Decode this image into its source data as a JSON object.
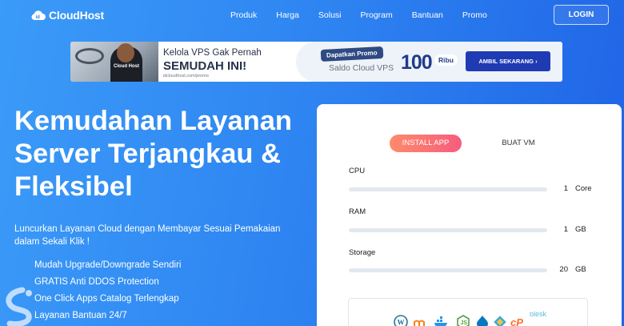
{
  "header": {
    "logo_badge": "id",
    "logo_text": "CloudHost",
    "menu": [
      "Produk",
      "Harga",
      "Solusi",
      "Program",
      "Bantuan",
      "Promo"
    ],
    "login_label": "LOGIN"
  },
  "banner": {
    "line1": "Kelola VPS Gak Pernah",
    "line2": "SEMUDAH INI!",
    "url": "idcloudhost.com/promo",
    "promo_tag": "Dapatkan Promo",
    "promo_sub": "Saldo Cloud VPS",
    "promo_amount": "100",
    "promo_unit": "Ribu",
    "cta_label": "AMBIL SEKARANG ›",
    "photo_shirt_text": "Cloud Host"
  },
  "hero": {
    "title": "Kemudahan Layanan Server Terjangkau & Fleksibel",
    "subtitle": "Luncurkan Layanan Cloud dengan Membayar Sesuai Pemakaian dalam Sekali Klik !",
    "features": [
      "Mudah Upgrade/Downgrade Sendiri",
      "GRATIS Anti DDOS Protection",
      "One Click Apps Catalog Terlengkap",
      "Layanan Bantuan 24/7"
    ]
  },
  "card": {
    "tabs": [
      "INSTALL APP",
      "BUAT VM"
    ],
    "resources": [
      {
        "label": "CPU",
        "value": "1",
        "unit": "Core"
      },
      {
        "label": "RAM",
        "value": "1",
        "unit": "GB"
      },
      {
        "label": "Storage",
        "value": "20",
        "unit": "GB"
      }
    ],
    "apps": [
      "wordpress",
      "moodle",
      "docker",
      "nodejs",
      "drupal",
      "git",
      "cpanel",
      "plesk"
    ],
    "plesk_label": "plesk",
    "cpanel_label": "cP"
  },
  "colors": {
    "bg_start": "#3b9bf8",
    "bg_end": "#1f63e6",
    "cta": "#1e3bb3",
    "install_tab_start": "#ff8a6a",
    "install_tab_end": "#f65d7e"
  }
}
